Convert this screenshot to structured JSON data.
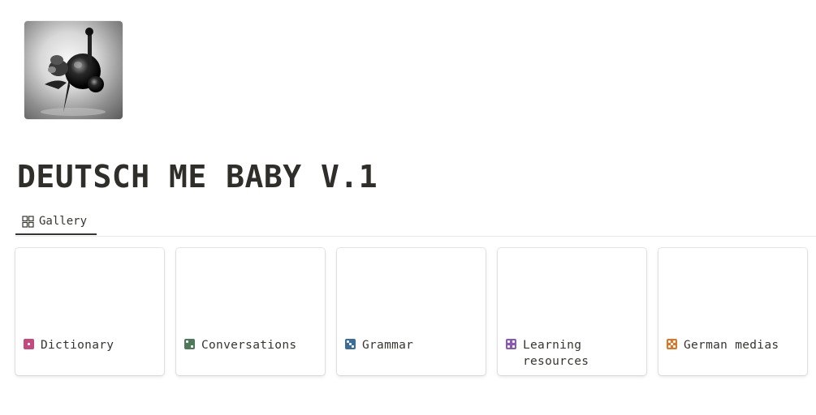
{
  "page": {
    "title": "DEUTSCH ME BABY V.1"
  },
  "tabs": [
    {
      "label": "Gallery",
      "icon": "gallery-grid-icon",
      "active": true
    }
  ],
  "cards": [
    {
      "label": "Dictionary",
      "icon": "die-one-icon",
      "color": "#c4497e"
    },
    {
      "label": "Conversations",
      "icon": "die-two-icon",
      "color": "#4f7a5a"
    },
    {
      "label": "Grammar",
      "icon": "die-three-icon",
      "color": "#3b6d99"
    },
    {
      "label": "Learning resources",
      "icon": "die-four-icon",
      "color": "#8a5ab0"
    },
    {
      "label": "German medias",
      "icon": "die-five-icon",
      "color": "#d9772b"
    }
  ]
}
